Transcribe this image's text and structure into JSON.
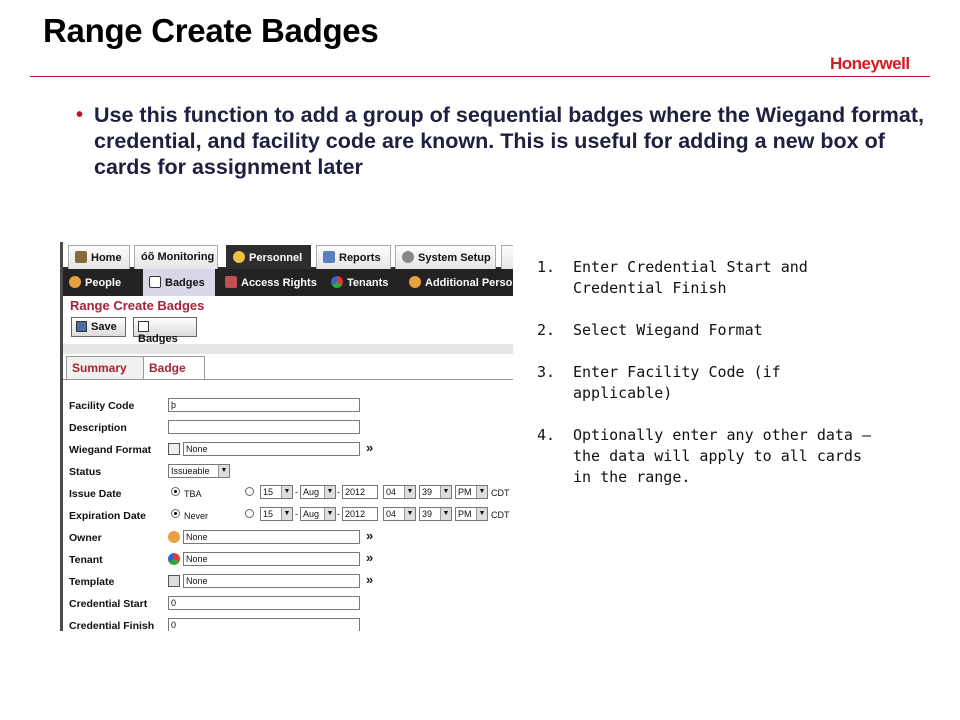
{
  "slide": {
    "title": "Range Create Badges",
    "logo": "Honeywell",
    "bullet": "Use this function to add a group of sequential badges where the Wiegand format, credential, and facility code are known.  This is useful for adding a new box of cards for assignment later"
  },
  "app": {
    "tabs": [
      {
        "label": "Home",
        "icon": "home-icon"
      },
      {
        "label": "Monitoring",
        "icon": "binoculars-icon"
      },
      {
        "label": "Personnel",
        "icon": "personnel-icon"
      },
      {
        "label": "Reports",
        "icon": "report-icon"
      },
      {
        "label": "System Setup",
        "icon": "setup-icon"
      }
    ],
    "subnav": [
      {
        "label": "People"
      },
      {
        "label": "Badges"
      },
      {
        "label": "Access Rights"
      },
      {
        "label": "Tenants"
      },
      {
        "label": "Additional Personn"
      }
    ],
    "page_title": "Range Create Badges",
    "buttons": {
      "save": "Save",
      "badges": "Badges"
    },
    "form_tabs": {
      "summary": "Summary",
      "badge": "Badge"
    },
    "fields": {
      "facility_code": {
        "label": "Facility Code",
        "value": "þ"
      },
      "description": {
        "label": "Description",
        "value": ""
      },
      "wiegand_format": {
        "label": "Wiegand Format",
        "value": "None"
      },
      "status": {
        "label": "Status",
        "value": "Issueable"
      },
      "issue_date": {
        "label": "Issue Date",
        "option_a": "TBA",
        "day": "15",
        "month": "Aug",
        "year": "2012",
        "hour": "04",
        "minute": "39",
        "ampm": "PM",
        "tz": "CDT"
      },
      "expiration_date": {
        "label": "Expiration Date",
        "option_a": "Never",
        "day": "15",
        "month": "Aug",
        "year": "2012",
        "hour": "04",
        "minute": "39",
        "ampm": "PM",
        "tz": "CDT"
      },
      "owner": {
        "label": "Owner",
        "value": "None"
      },
      "tenant": {
        "label": "Tenant",
        "value": "None"
      },
      "template": {
        "label": "Template",
        "value": "None"
      },
      "credential_start": {
        "label": "Credential Start",
        "value": "0"
      },
      "credential_finish": {
        "label": "Credential Finish",
        "value": "0"
      }
    },
    "more_symbol": "»",
    "dash": "-"
  },
  "steps": [
    {
      "num": "1.",
      "text": "Enter Credential Start and Credential Finish"
    },
    {
      "num": "2.",
      "text": "Select Wiegand Format"
    },
    {
      "num": "3.",
      "text": "Enter Facility Code (if applicable)"
    },
    {
      "num": "4.",
      "text": "Optionally enter any other data – the data will apply to all cards in the range."
    }
  ],
  "colors": {
    "accent_red": "#c8102e",
    "label_red": "#a3233a",
    "nav_dark": "#222222"
  }
}
